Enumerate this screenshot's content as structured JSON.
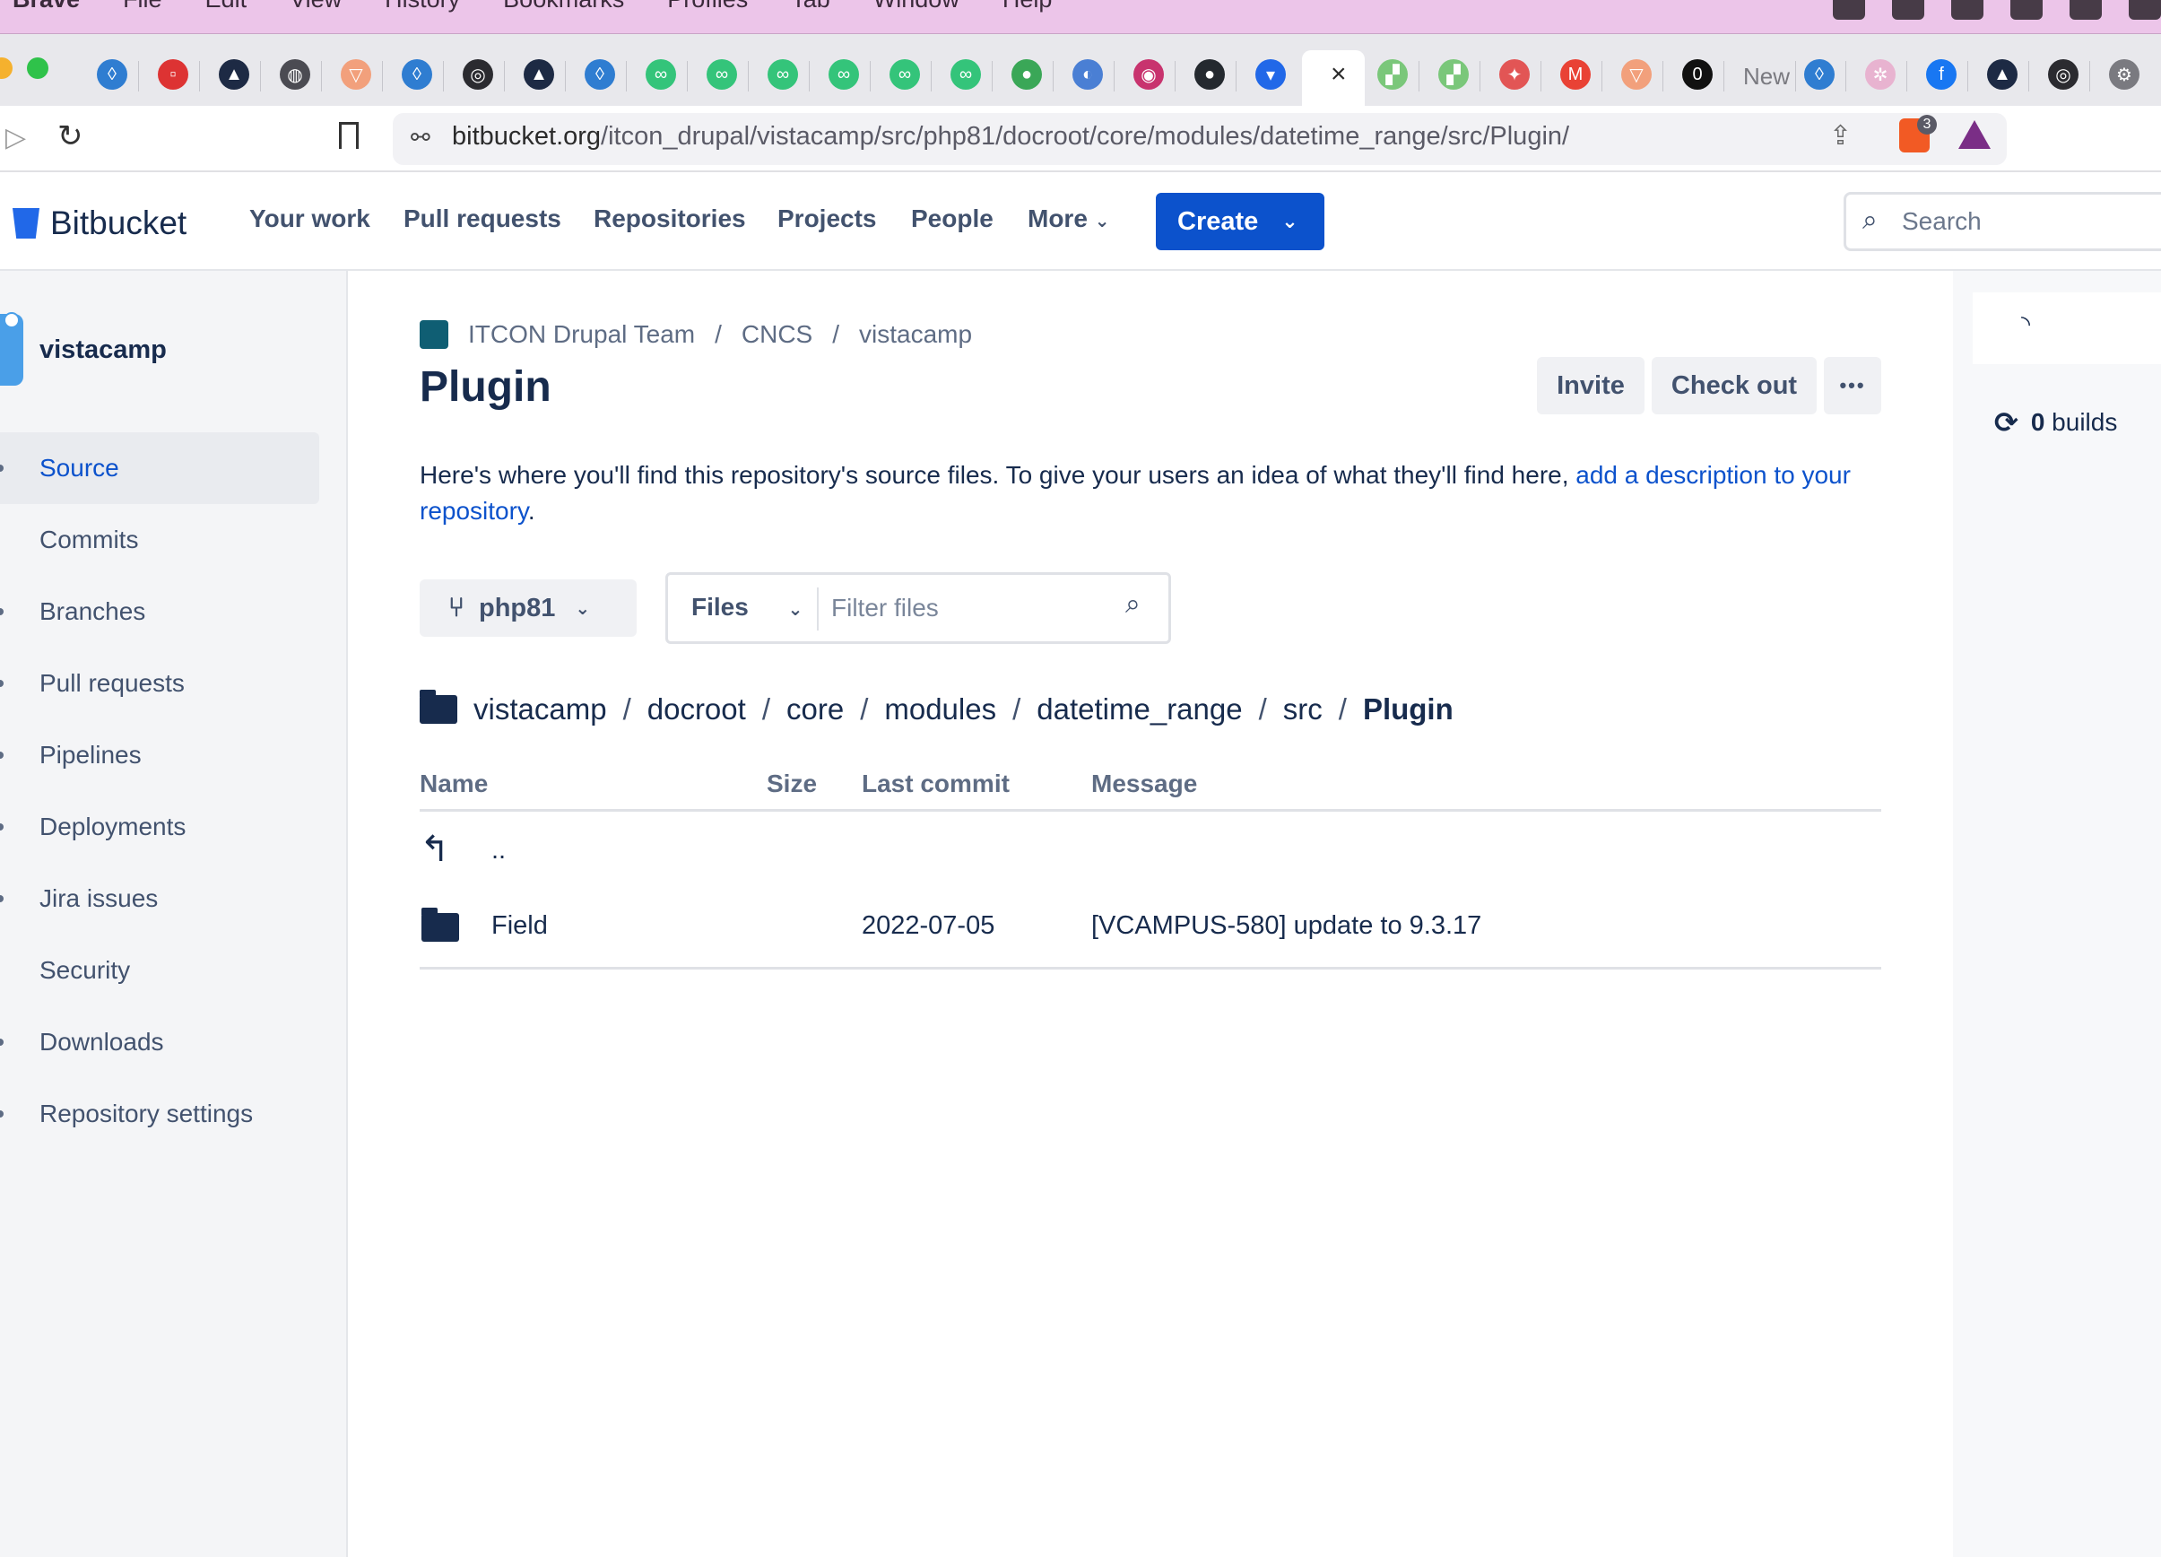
{
  "menubar": {
    "items": [
      "Brave",
      "File",
      "Edit",
      "View",
      "History",
      "Bookmarks",
      "Profiles",
      "Tab",
      "Window",
      "Help"
    ]
  },
  "browser": {
    "tab_new_label": "New",
    "url_host": "bitbucket.org",
    "url_path": "/itcon_drupal/vistacamp/src/php81/docroot/core/modules/datetime_range/src/Plugin/",
    "brave_badge": "3",
    "close_tab_glyph": "×"
  },
  "header": {
    "brand": "Bitbucket",
    "nav": [
      "Your work",
      "Pull requests",
      "Repositories",
      "Projects",
      "People",
      "More"
    ],
    "create_label": "Create",
    "search_placeholder": "Search"
  },
  "sidebar": {
    "repo_name": "vistacamp",
    "items": [
      {
        "label": "Source",
        "active": true
      },
      {
        "label": "Commits"
      },
      {
        "label": "Branches"
      },
      {
        "label": "Pull requests"
      },
      {
        "label": "Pipelines"
      },
      {
        "label": "Deployments"
      },
      {
        "label": "Jira issues"
      },
      {
        "label": "Security"
      },
      {
        "label": "Downloads"
      },
      {
        "label": "Repository settings"
      }
    ]
  },
  "main": {
    "breadcrumb": [
      "ITCON Drupal Team",
      "CNCS",
      "vistacamp"
    ],
    "title": "Plugin",
    "invite_label": "Invite",
    "checkout_label": "Check out",
    "more_glyph": "•••",
    "description": "Here's where you'll find this repository's source files. To give your users an idea of what they'll find here, ",
    "description_link": "add a description to your repository",
    "description_end": ".",
    "branch": "php81",
    "files_label": "Files",
    "filter_placeholder": "Filter files",
    "path": [
      "vistacamp",
      "docroot",
      "core",
      "modules",
      "datetime_range",
      "src",
      "Plugin"
    ],
    "columns": [
      "Name",
      "Size",
      "Last commit",
      "Message"
    ],
    "parent_row": "..",
    "rows": [
      {
        "name": "Field",
        "size": "",
        "last_commit": "2022-07-05",
        "message": "[VCAMPUS-580] update to 9.3.17"
      }
    ]
  },
  "right_panel": {
    "builds_count": "0",
    "builds_label": "builds"
  },
  "colors": {
    "accent": "#0c52cc",
    "menubar": "#ecc5e9",
    "text": "#172b4d"
  }
}
